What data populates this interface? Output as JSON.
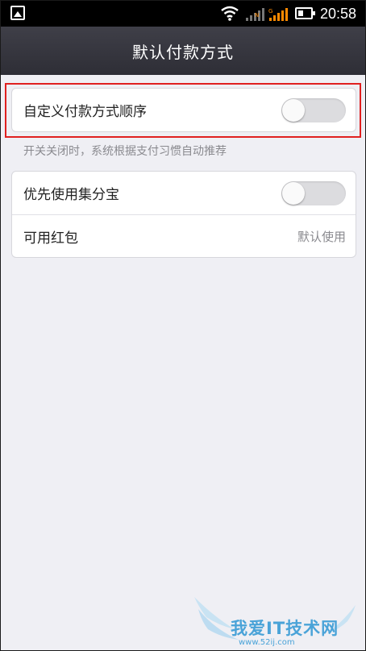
{
  "status_bar": {
    "time": "20:58",
    "icons": [
      "gallery-icon",
      "wifi-icon",
      "signal-icon",
      "signal-icon",
      "battery-icon"
    ],
    "colors": {
      "signal_accent": "#ff8a00"
    }
  },
  "title_bar": {
    "title": "默认付款方式"
  },
  "settings": {
    "custom_order": {
      "label": "自定义付款方式顺序",
      "toggle_on": false
    },
    "hint": "开关关闭时，系统根据支付习惯自动推荐",
    "jifenbao": {
      "label": "优先使用集分宝",
      "toggle_on": false
    },
    "red_packet": {
      "label": "可用红包",
      "value": "默认使用"
    }
  },
  "watermark": {
    "text": "我爱IT技术网",
    "url": "www.52ij.com"
  },
  "colors": {
    "title_bar": "#34343c",
    "highlight_box": "#e02020",
    "background": "#efeff4"
  }
}
